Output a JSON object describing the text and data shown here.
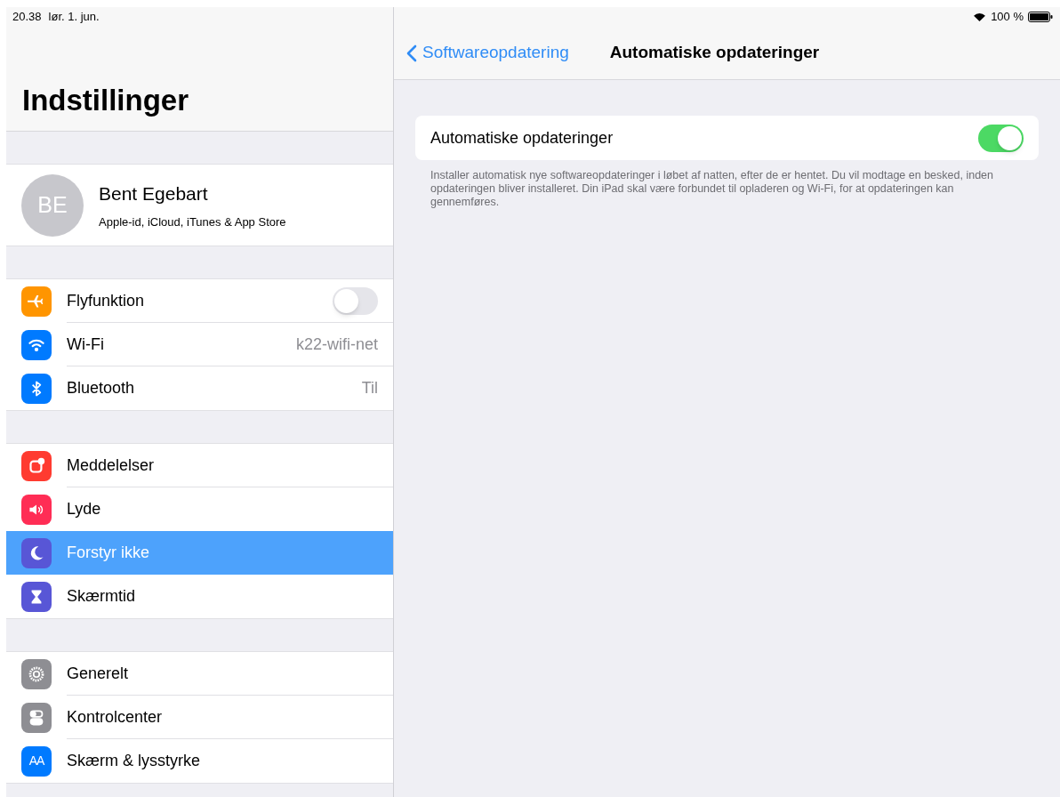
{
  "status_bar": {
    "time": "20.38",
    "date": "lør. 1. jun.",
    "battery": "100 %"
  },
  "sidebar": {
    "title": "Indstillinger",
    "profile": {
      "initials": "BE",
      "name": "Bent Egebart",
      "subtitle": "Apple-id, iCloud, iTunes & App Store"
    },
    "groups": [
      [
        {
          "label": "Flyfunktion",
          "kind": "toggle",
          "on": false,
          "color": "#ff9500",
          "selected": false
        },
        {
          "label": "Wi-Fi",
          "kind": "value",
          "value": "k22-wifi-net",
          "color": "#007aff",
          "selected": false
        },
        {
          "label": "Bluetooth",
          "kind": "value",
          "value": "Til",
          "color": "#007aff",
          "selected": false
        }
      ],
      [
        {
          "label": "Meddelelser",
          "kind": "plain",
          "color": "#ff3b30",
          "selected": false
        },
        {
          "label": "Lyde",
          "kind": "plain",
          "color": "#ff2d55",
          "selected": false
        },
        {
          "label": "Forstyr ikke",
          "kind": "plain",
          "color": "#5856d6",
          "selected": true
        },
        {
          "label": "Skærmtid",
          "kind": "plain",
          "color": "#5856d6",
          "selected": false
        }
      ],
      [
        {
          "label": "Generelt",
          "kind": "plain",
          "color": "#8e8e93",
          "selected": false
        },
        {
          "label": "Kontrolcenter",
          "kind": "plain",
          "color": "#8e8e93",
          "selected": false
        },
        {
          "label": "Skærm & lysstyrke",
          "kind": "plain",
          "color": "#007aff",
          "selected": false,
          "icon_text": "AA"
        }
      ]
    ]
  },
  "detail": {
    "back": "Softwareopdatering",
    "title": "Automatiske opdateringer",
    "setting": {
      "label": "Automatiske opdateringer",
      "on": true
    },
    "footer": "Installer automatisk nye softwareopdateringer i løbet af natten, efter de er hentet. Du vil modtage en besked, inden opdateringen bliver installeret. Din iPad skal være forbundet til opladeren og Wi-Fi, for at opdateringen kan gennemføres."
  }
}
